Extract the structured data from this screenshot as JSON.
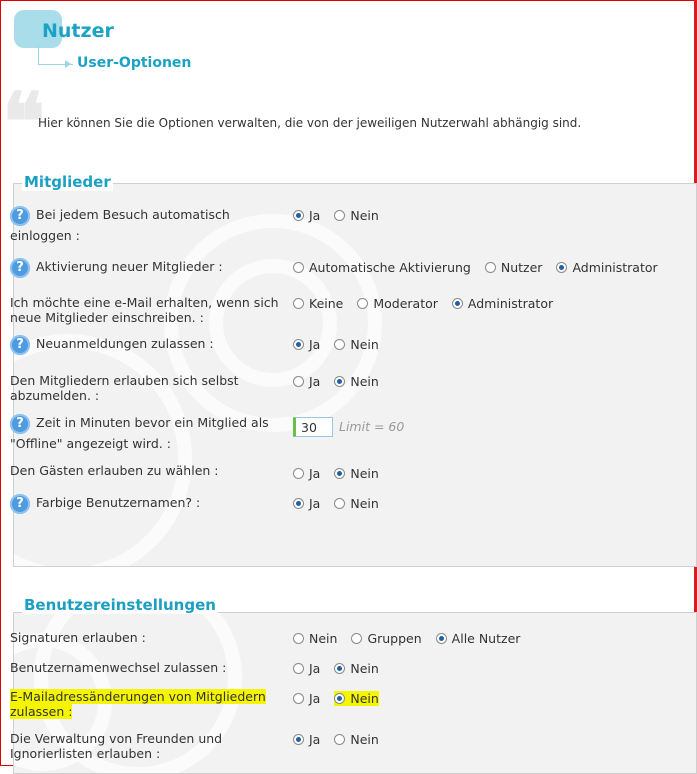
{
  "header": {
    "title": "Nutzer",
    "subtitle": "User-Optionen"
  },
  "intro": "Hier können Sie die Optionen verwalten, die von der jeweiligen Nutzerwahl abhängig sind.",
  "sections": [
    {
      "legend": "Mitglieder",
      "rows": [
        {
          "label": "Bei jedem Besuch automatisch einloggen :",
          "help": true,
          "options": [
            "Ja",
            "Nein"
          ],
          "selected": 0
        },
        {
          "label": "Aktivierung neuer Mitglieder :",
          "help": true,
          "options": [
            "Automatische Aktivierung",
            "Nutzer",
            "Administrator"
          ],
          "selected": 2
        },
        {
          "label": "Ich möchte eine e-Mail erhalten, wenn sich neue Mitglieder einschreiben. :",
          "help": false,
          "options": [
            "Keine",
            "Moderator",
            "Administrator"
          ],
          "selected": 2
        },
        {
          "label": "Neuanmeldungen zulassen :",
          "help": true,
          "options": [
            "Ja",
            "Nein"
          ],
          "selected": 0
        },
        {
          "label": "Den Mitgliedern erlauben sich selbst abzumelden. :",
          "help": false,
          "options": [
            "Ja",
            "Nein"
          ],
          "selected": 1
        },
        {
          "label": "Zeit in Minuten bevor ein Mitglied als \"Offline\" angezeigt wird. :",
          "help": true,
          "input_value": "30",
          "hint": "Limit = 60"
        },
        {
          "label": "Den Gästen erlauben zu wählen :",
          "help": false,
          "options": [
            "Ja",
            "Nein"
          ],
          "selected": 1
        },
        {
          "label": "Farbige Benutzernamen? :",
          "help": true,
          "options": [
            "Ja",
            "Nein"
          ],
          "selected": 0
        }
      ]
    },
    {
      "legend": "Benutzereinstellungen",
      "rows": [
        {
          "label": "Signaturen erlauben :",
          "help": false,
          "options": [
            "Nein",
            "Gruppen",
            "Alle Nutzer"
          ],
          "selected": 2
        },
        {
          "label": "Benutzernamenwechsel zulassen :",
          "help": false,
          "options": [
            "Ja",
            "Nein"
          ],
          "selected": 1
        },
        {
          "label": "E-Mailadressänderungen von Mitgliedern zulassen :",
          "help": false,
          "options": [
            "Ja",
            "Nein"
          ],
          "selected": 1,
          "highlighted": true
        },
        {
          "label": "Die Verwaltung von Freunden und Ignorierlisten erlauben :",
          "help": false,
          "options": [
            "Ja",
            "Nein"
          ],
          "selected": 0
        }
      ]
    }
  ],
  "colors": {
    "accent": "#1ba2c4",
    "highlight": "#f5f500",
    "frame": "#e00000"
  }
}
